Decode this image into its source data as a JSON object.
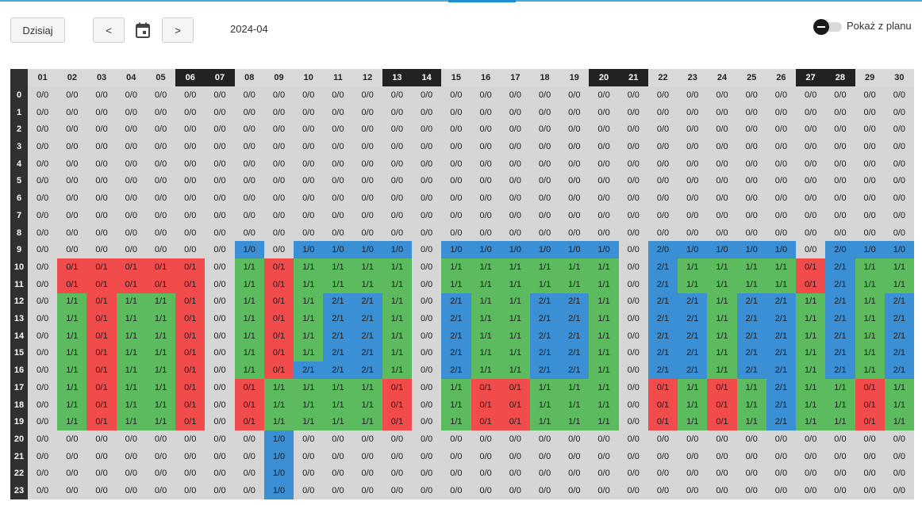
{
  "toolbar": {
    "today_label": "Dzisiaj",
    "prev_label": "<",
    "next_label": ">",
    "calendar_icon": "calendar-icon",
    "month": "2024-04",
    "toggle_label": "Pokaż z planu",
    "toggle_on": false
  },
  "colors": {
    "grey": "#d6d6d6",
    "red": "#f24b4b",
    "green": "#5cba5f",
    "blue": "#3b8fd4",
    "header_dark": "#303030",
    "accent": "#1f8fd1"
  },
  "schedule": {
    "days": [
      "01",
      "02",
      "03",
      "04",
      "05",
      "06",
      "07",
      "08",
      "09",
      "10",
      "11",
      "12",
      "13",
      "14",
      "15",
      "16",
      "17",
      "18",
      "19",
      "20",
      "21",
      "22",
      "23",
      "24",
      "25",
      "26",
      "27",
      "28",
      "29",
      "30"
    ],
    "weekend_days": [
      "06",
      "07",
      "13",
      "14",
      "20",
      "21",
      "27",
      "28"
    ],
    "hours": [
      "0",
      "1",
      "2",
      "3",
      "4",
      "5",
      "6",
      "7",
      "8",
      "9",
      "10",
      "11",
      "12",
      "13",
      "14",
      "15",
      "16",
      "17",
      "18",
      "19",
      "20",
      "21",
      "22",
      "23"
    ],
    "rows": [
      [
        "0/0",
        "0/0",
        "0/0",
        "0/0",
        "0/0",
        "0/0",
        "0/0",
        "0/0",
        "0/0",
        "0/0",
        "0/0",
        "0/0",
        "0/0",
        "0/0",
        "0/0",
        "0/0",
        "0/0",
        "0/0",
        "0/0",
        "0/0",
        "0/0",
        "0/0",
        "0/0",
        "0/0",
        "0/0",
        "0/0",
        "0/0",
        "0/0",
        "0/0",
        "0/0"
      ],
      [
        "0/0",
        "0/0",
        "0/0",
        "0/0",
        "0/0",
        "0/0",
        "0/0",
        "0/0",
        "0/0",
        "0/0",
        "0/0",
        "0/0",
        "0/0",
        "0/0",
        "0/0",
        "0/0",
        "0/0",
        "0/0",
        "0/0",
        "0/0",
        "0/0",
        "0/0",
        "0/0",
        "0/0",
        "0/0",
        "0/0",
        "0/0",
        "0/0",
        "0/0",
        "0/0"
      ],
      [
        "0/0",
        "0/0",
        "0/0",
        "0/0",
        "0/0",
        "0/0",
        "0/0",
        "0/0",
        "0/0",
        "0/0",
        "0/0",
        "0/0",
        "0/0",
        "0/0",
        "0/0",
        "0/0",
        "0/0",
        "0/0",
        "0/0",
        "0/0",
        "0/0",
        "0/0",
        "0/0",
        "0/0",
        "0/0",
        "0/0",
        "0/0",
        "0/0",
        "0/0",
        "0/0"
      ],
      [
        "0/0",
        "0/0",
        "0/0",
        "0/0",
        "0/0",
        "0/0",
        "0/0",
        "0/0",
        "0/0",
        "0/0",
        "0/0",
        "0/0",
        "0/0",
        "0/0",
        "0/0",
        "0/0",
        "0/0",
        "0/0",
        "0/0",
        "0/0",
        "0/0",
        "0/0",
        "0/0",
        "0/0",
        "0/0",
        "0/0",
        "0/0",
        "0/0",
        "0/0",
        "0/0"
      ],
      [
        "0/0",
        "0/0",
        "0/0",
        "0/0",
        "0/0",
        "0/0",
        "0/0",
        "0/0",
        "0/0",
        "0/0",
        "0/0",
        "0/0",
        "0/0",
        "0/0",
        "0/0",
        "0/0",
        "0/0",
        "0/0",
        "0/0",
        "0/0",
        "0/0",
        "0/0",
        "0/0",
        "0/0",
        "0/0",
        "0/0",
        "0/0",
        "0/0",
        "0/0",
        "0/0"
      ],
      [
        "0/0",
        "0/0",
        "0/0",
        "0/0",
        "0/0",
        "0/0",
        "0/0",
        "0/0",
        "0/0",
        "0/0",
        "0/0",
        "0/0",
        "0/0",
        "0/0",
        "0/0",
        "0/0",
        "0/0",
        "0/0",
        "0/0",
        "0/0",
        "0/0",
        "0/0",
        "0/0",
        "0/0",
        "0/0",
        "0/0",
        "0/0",
        "0/0",
        "0/0",
        "0/0"
      ],
      [
        "0/0",
        "0/0",
        "0/0",
        "0/0",
        "0/0",
        "0/0",
        "0/0",
        "0/0",
        "0/0",
        "0/0",
        "0/0",
        "0/0",
        "0/0",
        "0/0",
        "0/0",
        "0/0",
        "0/0",
        "0/0",
        "0/0",
        "0/0",
        "0/0",
        "0/0",
        "0/0",
        "0/0",
        "0/0",
        "0/0",
        "0/0",
        "0/0",
        "0/0",
        "0/0"
      ],
      [
        "0/0",
        "0/0",
        "0/0",
        "0/0",
        "0/0",
        "0/0",
        "0/0",
        "0/0",
        "0/0",
        "0/0",
        "0/0",
        "0/0",
        "0/0",
        "0/0",
        "0/0",
        "0/0",
        "0/0",
        "0/0",
        "0/0",
        "0/0",
        "0/0",
        "0/0",
        "0/0",
        "0/0",
        "0/0",
        "0/0",
        "0/0",
        "0/0",
        "0/0",
        "0/0"
      ],
      [
        "0/0",
        "0/0",
        "0/0",
        "0/0",
        "0/0",
        "0/0",
        "0/0",
        "0/0",
        "0/0",
        "0/0",
        "0/0",
        "0/0",
        "0/0",
        "0/0",
        "0/0",
        "0/0",
        "0/0",
        "0/0",
        "0/0",
        "0/0",
        "0/0",
        "0/0",
        "0/0",
        "0/0",
        "0/0",
        "0/0",
        "0/0",
        "0/0",
        "0/0",
        "0/0"
      ],
      [
        "0/0",
        "0/0",
        "0/0",
        "0/0",
        "0/0",
        "0/0",
        "0/0",
        "1/0",
        "0/0",
        "1/0",
        "1/0",
        "1/0",
        "1/0",
        "0/0",
        "1/0",
        "1/0",
        "1/0",
        "1/0",
        "1/0",
        "1/0",
        "0/0",
        "2/0",
        "1/0",
        "1/0",
        "1/0",
        "1/0",
        "0/0",
        "2/0",
        "1/0",
        "1/0"
      ],
      [
        "0/0",
        "0/1",
        "0/1",
        "0/1",
        "0/1",
        "0/1",
        "0/0",
        "1/1",
        "0/1",
        "1/1",
        "1/1",
        "1/1",
        "1/1",
        "0/0",
        "1/1",
        "1/1",
        "1/1",
        "1/1",
        "1/1",
        "1/1",
        "0/0",
        "2/1",
        "1/1",
        "1/1",
        "1/1",
        "1/1",
        "0/1",
        "2/1",
        "1/1",
        "1/1"
      ],
      [
        "0/0",
        "0/1",
        "0/1",
        "0/1",
        "0/1",
        "0/1",
        "0/0",
        "1/1",
        "0/1",
        "1/1",
        "1/1",
        "1/1",
        "1/1",
        "0/0",
        "1/1",
        "1/1",
        "1/1",
        "1/1",
        "1/1",
        "1/1",
        "0/0",
        "2/1",
        "1/1",
        "1/1",
        "1/1",
        "1/1",
        "0/1",
        "2/1",
        "1/1",
        "1/1"
      ],
      [
        "0/0",
        "1/1",
        "0/1",
        "1/1",
        "1/1",
        "0/1",
        "0/0",
        "1/1",
        "0/1",
        "1/1",
        "2/1",
        "2/1",
        "1/1",
        "0/0",
        "2/1",
        "1/1",
        "1/1",
        "2/1",
        "2/1",
        "1/1",
        "0/0",
        "2/1",
        "2/1",
        "1/1",
        "2/1",
        "2/1",
        "1/1",
        "2/1",
        "1/1",
        "2/1"
      ],
      [
        "0/0",
        "1/1",
        "0/1",
        "1/1",
        "1/1",
        "0/1",
        "0/0",
        "1/1",
        "0/1",
        "1/1",
        "2/1",
        "2/1",
        "1/1",
        "0/0",
        "2/1",
        "1/1",
        "1/1",
        "2/1",
        "2/1",
        "1/1",
        "0/0",
        "2/1",
        "2/1",
        "1/1",
        "2/1",
        "2/1",
        "1/1",
        "2/1",
        "1/1",
        "2/1"
      ],
      [
        "0/0",
        "1/1",
        "0/1",
        "1/1",
        "1/1",
        "0/1",
        "0/0",
        "1/1",
        "0/1",
        "1/1",
        "2/1",
        "2/1",
        "1/1",
        "0/0",
        "2/1",
        "1/1",
        "1/1",
        "2/1",
        "2/1",
        "1/1",
        "0/0",
        "2/1",
        "2/1",
        "1/1",
        "2/1",
        "2/1",
        "1/1",
        "2/1",
        "1/1",
        "2/1"
      ],
      [
        "0/0",
        "1/1",
        "0/1",
        "1/1",
        "1/1",
        "0/1",
        "0/0",
        "1/1",
        "0/1",
        "1/1",
        "2/1",
        "2/1",
        "1/1",
        "0/0",
        "2/1",
        "1/1",
        "1/1",
        "2/1",
        "2/1",
        "1/1",
        "0/0",
        "2/1",
        "2/1",
        "1/1",
        "2/1",
        "2/1",
        "1/1",
        "2/1",
        "1/1",
        "2/1"
      ],
      [
        "0/0",
        "1/1",
        "0/1",
        "1/1",
        "1/1",
        "0/1",
        "0/0",
        "1/1",
        "0/1",
        "2/1",
        "2/1",
        "2/1",
        "1/1",
        "0/0",
        "2/1",
        "1/1",
        "1/1",
        "2/1",
        "2/1",
        "1/1",
        "0/0",
        "2/1",
        "2/1",
        "1/1",
        "2/1",
        "2/1",
        "1/1",
        "2/1",
        "1/1",
        "2/1"
      ],
      [
        "0/0",
        "1/1",
        "0/1",
        "1/1",
        "1/1",
        "0/1",
        "0/0",
        "0/1",
        "1/1",
        "1/1",
        "1/1",
        "1/1",
        "0/1",
        "0/0",
        "1/1",
        "0/1",
        "0/1",
        "1/1",
        "1/1",
        "1/1",
        "0/0",
        "0/1",
        "1/1",
        "0/1",
        "1/1",
        "2/1",
        "1/1",
        "1/1",
        "0/1",
        "1/1"
      ],
      [
        "0/0",
        "1/1",
        "0/1",
        "1/1",
        "1/1",
        "0/1",
        "0/0",
        "0/1",
        "1/1",
        "1/1",
        "1/1",
        "1/1",
        "0/1",
        "0/0",
        "1/1",
        "0/1",
        "0/1",
        "1/1",
        "1/1",
        "1/1",
        "0/0",
        "0/1",
        "1/1",
        "0/1",
        "1/1",
        "2/1",
        "1/1",
        "1/1",
        "0/1",
        "1/1"
      ],
      [
        "0/0",
        "1/1",
        "0/1",
        "1/1",
        "1/1",
        "0/1",
        "0/0",
        "0/1",
        "1/1",
        "1/1",
        "1/1",
        "1/1",
        "0/1",
        "0/0",
        "1/1",
        "0/1",
        "0/1",
        "1/1",
        "1/1",
        "1/1",
        "0/0",
        "0/1",
        "1/1",
        "0/1",
        "1/1",
        "2/1",
        "1/1",
        "1/1",
        "0/1",
        "1/1"
      ],
      [
        "0/0",
        "0/0",
        "0/0",
        "0/0",
        "0/0",
        "0/0",
        "0/0",
        "0/0",
        "1/0",
        "0/0",
        "0/0",
        "0/0",
        "0/0",
        "0/0",
        "0/0",
        "0/0",
        "0/0",
        "0/0",
        "0/0",
        "0/0",
        "0/0",
        "0/0",
        "0/0",
        "0/0",
        "0/0",
        "0/0",
        "0/0",
        "0/0",
        "0/0",
        "0/0"
      ],
      [
        "0/0",
        "0/0",
        "0/0",
        "0/0",
        "0/0",
        "0/0",
        "0/0",
        "0/0",
        "1/0",
        "0/0",
        "0/0",
        "0/0",
        "0/0",
        "0/0",
        "0/0",
        "0/0",
        "0/0",
        "0/0",
        "0/0",
        "0/0",
        "0/0",
        "0/0",
        "0/0",
        "0/0",
        "0/0",
        "0/0",
        "0/0",
        "0/0",
        "0/0",
        "0/0"
      ],
      [
        "0/0",
        "0/0",
        "0/0",
        "0/0",
        "0/0",
        "0/0",
        "0/0",
        "0/0",
        "1/0",
        "0/0",
        "0/0",
        "0/0",
        "0/0",
        "0/0",
        "0/0",
        "0/0",
        "0/0",
        "0/0",
        "0/0",
        "0/0",
        "0/0",
        "0/0",
        "0/0",
        "0/0",
        "0/0",
        "0/0",
        "0/0",
        "0/0",
        "0/0",
        "0/0"
      ],
      [
        "0/0",
        "0/0",
        "0/0",
        "0/0",
        "0/0",
        "0/0",
        "0/0",
        "0/0",
        "1/0",
        "0/0",
        "0/0",
        "0/0",
        "0/0",
        "0/0",
        "0/0",
        "0/0",
        "0/0",
        "0/0",
        "0/0",
        "0/0",
        "0/0",
        "0/0",
        "0/0",
        "0/0",
        "0/0",
        "0/0",
        "0/0",
        "0/0",
        "0/0",
        "0/0"
      ]
    ],
    "status_rows": [
      "GGGGGGGGGGGGGGGGGGGGGGGGGGGGGG",
      "GGGGGGGGGGGGGGGGGGGGGGGGGGGGGG",
      "GGGGGGGGGGGGGGGGGGGGGGGGGGGGGG",
      "GGGGGGGGGGGGGGGGGGGGGGGGGGGGGG",
      "GGGGGGGGGGGGGGGGGGGGGGGGGGGGGG",
      "GGGGGGGGGGGGGGGGGGGGGGGGGGGGGG",
      "GGGGGGGGGGGGGGGGGGGGGGGGGGGGGG",
      "GGGGGGGGGGGGGGGGGGGGGGGGGGGGGG",
      "GGGGGGGGGGGGGGGGGGGGGGGGGGGGGG",
      "GGGGGGGBGBBBBGBBBBBBGBBBBBGBBB",
      "GRRRRRGNRNNNNGNNNNNNGBNNNNRBNN",
      "GRRRRRGNRNNNNGNNNNNNGBNNNNRBNN",
      "GNRNNRGNRNBBNGBNNBBNGBBNBBNBNB",
      "GNRNNRGNRNBBNGBNNBBNGBBNBBNBNB",
      "GNRNNRGNRNBBNGBNNBBNGBBNBBNBNB",
      "GNRNNRGNRNBBNGBNNBBNGBBNBBNBNB",
      "GNRNNRGNRBBBNGBNNBBNGBBNBBNBNB",
      "GNRNNRGRNNNNRGNRRNNNGRNRNBNNRN",
      "GNRNNRGRNNNNRGNRRNNNGRNRNBNNRN",
      "GNRNNRGRNNNNRGNRRNNNGRNRNBNNRN",
      "GGGGGGGGBGGGGGGGGGGGGGGGGGGGGG",
      "GGGGGGGGBGGGGGGGGGGGGGGGGGGGGG",
      "GGGGGGGGBGGGGGGGGGGGGGGGGGGGGG",
      "GGGGGGGGBGGGGGGGGGGGGGGGGGGGGG"
    ]
  }
}
